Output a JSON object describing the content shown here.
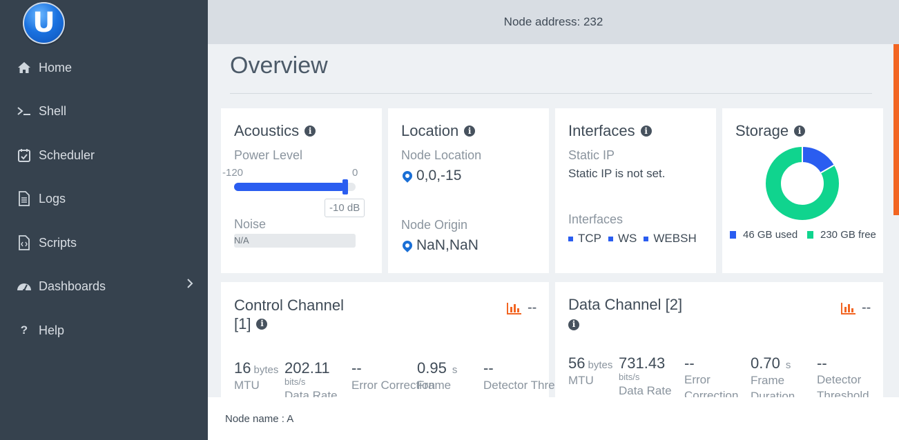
{
  "app": {
    "logo_letter": "U"
  },
  "sidebar": {
    "items": [
      {
        "label": "Home",
        "icon": "home-icon"
      },
      {
        "label": "Shell",
        "icon": "terminal-icon"
      },
      {
        "label": "Scheduler",
        "icon": "calendar-icon"
      },
      {
        "label": "Logs",
        "icon": "document-icon"
      },
      {
        "label": "Scripts",
        "icon": "code-file-icon"
      },
      {
        "label": "Dashboards",
        "icon": "dashboard-icon",
        "has_submenu": true
      },
      {
        "label": "Help",
        "icon": "question-icon"
      }
    ]
  },
  "header": {
    "node_address": "Node address: 232"
  },
  "main": {
    "title": "Overview",
    "acoustics": {
      "title": "Acoustics",
      "power_label": "Power Level",
      "min": "-120",
      "max": "0",
      "value_db": -10,
      "tooltip": "-10 dB",
      "noise_label": "Noise",
      "noise_value": "N/A"
    },
    "location": {
      "title": "Location",
      "node_location_label": "Node Location",
      "node_location": "0,0,-15",
      "node_origin_label": "Node Origin",
      "node_origin": "NaN,NaN"
    },
    "interfaces": {
      "title": "Interfaces",
      "static_ip_label": "Static IP",
      "static_ip_value": "Static IP is not set.",
      "interfaces_label": "Interfaces",
      "list": [
        "TCP",
        "WS",
        "WEBSH"
      ]
    },
    "storage": {
      "title": "Storage",
      "used_label": "46 GB used",
      "free_label": "230 GB free",
      "used_gb": 46,
      "free_gb": 230,
      "used_color": "#2a5df0",
      "free_color": "#10d48e"
    },
    "control_channel": {
      "title_line1": "Control Channel",
      "title_line2": "[1]",
      "chart_value": "--",
      "mtu_value": "16",
      "mtu_unit": "bytes",
      "mtu_label": "MTU",
      "data_rate_value": "202.11",
      "data_rate_unit": "bits/s",
      "data_rate_label": "Data Rate",
      "error_value": "--",
      "error_label": "Error Correction",
      "frame_value": "0.95",
      "frame_unit": "s",
      "frame_label": "Frame",
      "detector_value": "--",
      "detector_label": "Detector Threshold"
    },
    "data_channel": {
      "title": "Data Channel [2]",
      "chart_value": "--",
      "mtu_value": "56",
      "mtu_unit": "bytes",
      "mtu_label": "MTU",
      "data_rate_value": "731.43",
      "data_rate_unit": "bits/s",
      "data_rate_label": "Data Rate",
      "error_value": "--",
      "error_label_1": "Error",
      "error_label_2": "Correction",
      "frame_value": "0.70",
      "frame_unit": "s",
      "frame_label_1": "Frame",
      "frame_label_2": "Duration",
      "detector_value": "--",
      "detector_label_1": "Detector",
      "detector_label_2": "Threshold"
    }
  },
  "footer": {
    "node_name": "Node name : A"
  },
  "colors": {
    "accent": "#2a5df0",
    "scroll": "#f26522",
    "sidebar": "#36424e",
    "chart_icon": "#f26522"
  }
}
